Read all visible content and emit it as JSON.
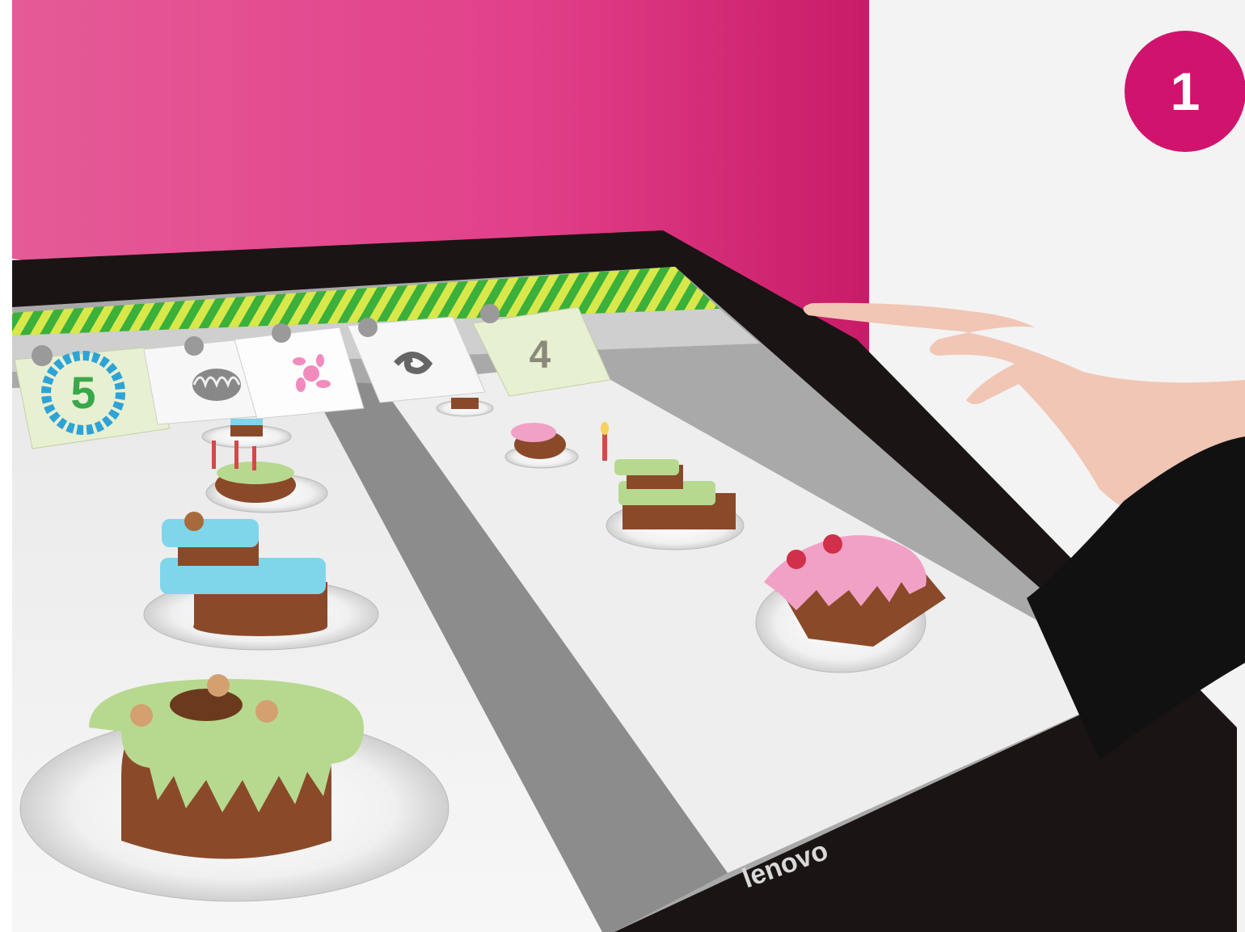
{
  "step_badge": "1",
  "device_brand": "lenovo",
  "hud": {
    "timer_value": "5",
    "score_value": "4",
    "order_cards": [
      {
        "icon": "bundt-mold-icon"
      },
      {
        "icon": "pink-splat-icon"
      },
      {
        "icon": "swirl-icon"
      }
    ]
  },
  "cakes": [
    {
      "type": "bundt",
      "icing": "green",
      "lane": "left"
    },
    {
      "type": "two-tier",
      "icing": "blue",
      "lane": "left"
    },
    {
      "type": "candle-bundt",
      "icing": "green",
      "lane": "left"
    },
    {
      "type": "layer",
      "icing": "blue",
      "lane": "left"
    },
    {
      "type": "bundt",
      "icing": "pink",
      "lane": "right"
    },
    {
      "type": "two-tier-candle",
      "icing": "green",
      "lane": "right"
    },
    {
      "type": "slice",
      "icing": "pink",
      "lane": "right"
    },
    {
      "type": "small",
      "icing": "brown",
      "lane": "right"
    }
  ],
  "colors": {
    "wall_pink": "#e0377f",
    "badge": "#d0146e",
    "awning_green": "#3bb03b",
    "awning_yellow": "#d8e84a",
    "icing_green": "#b7d98f",
    "icing_blue": "#7fd6ea",
    "icing_pink": "#f2a1c6",
    "cake_brown": "#8a4a2a"
  }
}
